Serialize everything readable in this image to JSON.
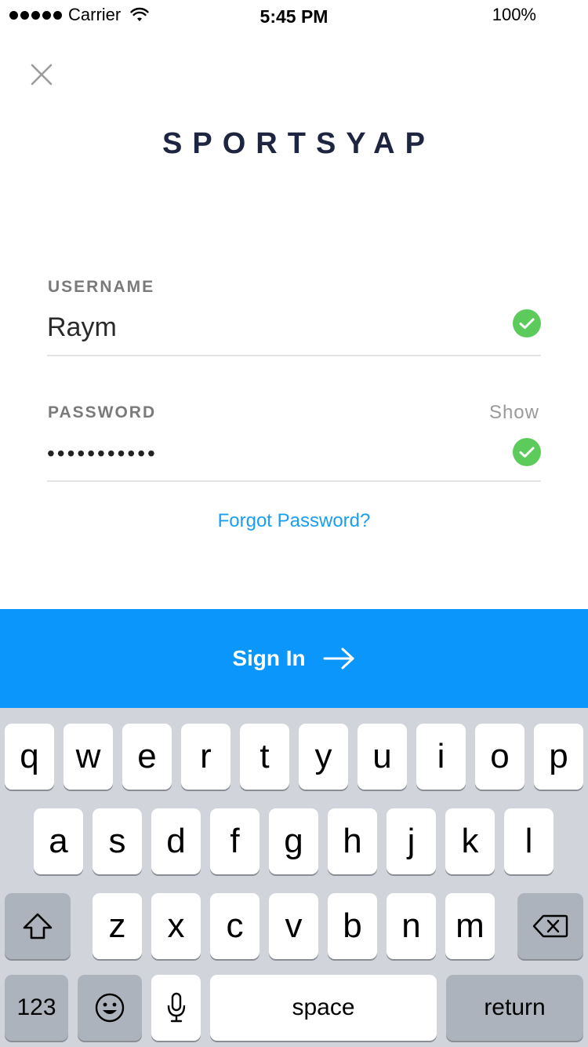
{
  "status_bar": {
    "carrier": "Carrier",
    "time": "5:45 PM",
    "battery": "100%"
  },
  "logo": "SPORTSYAP",
  "form": {
    "username": {
      "label": "USERNAME",
      "value": "Raym"
    },
    "password": {
      "label": "PASSWORD",
      "value": "•••••••••••",
      "show_label": "Show"
    },
    "forgot_label": "Forgot Password?"
  },
  "signin": {
    "label": "Sign In"
  },
  "keyboard": {
    "row1": [
      "q",
      "w",
      "e",
      "r",
      "t",
      "y",
      "u",
      "i",
      "o",
      "p"
    ],
    "row2": [
      "a",
      "s",
      "d",
      "f",
      "g",
      "h",
      "j",
      "k",
      "l"
    ],
    "row3": [
      "z",
      "x",
      "c",
      "v",
      "b",
      "n",
      "m"
    ],
    "numbers_label": "123",
    "space_label": "space",
    "return_label": "return"
  },
  "colors": {
    "accent": "#0a96fa",
    "link": "#1a9ef0",
    "valid": "#5dcb5b",
    "logo": "#1e2540"
  }
}
